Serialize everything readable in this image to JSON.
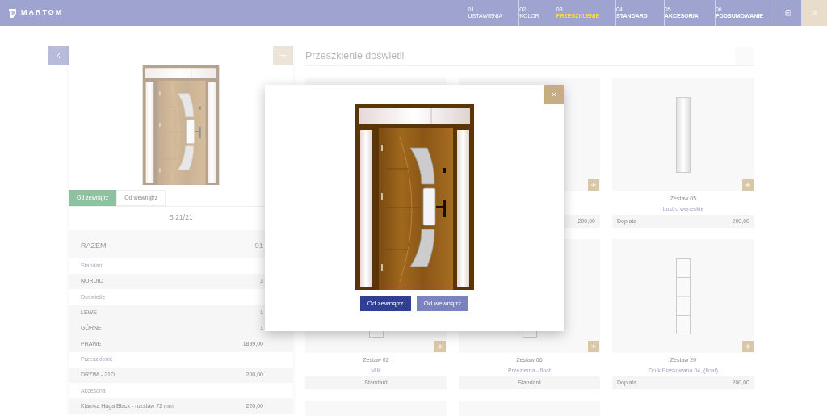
{
  "brand": {
    "name": "MARTOM"
  },
  "steps": [
    {
      "number": "01",
      "label": "USTAWIENIA",
      "selected": false,
      "completed": true
    },
    {
      "number": "02",
      "label": "KOLOR",
      "selected": false,
      "completed": true
    },
    {
      "number": "03",
      "label": "PRZESZKLENIE",
      "selected": true,
      "completed": false
    },
    {
      "number": "04",
      "label": "STANDARD",
      "selected": false,
      "completed": false
    },
    {
      "number": "05",
      "label": "AKCESORIA",
      "selected": false,
      "completed": false
    },
    {
      "number": "06",
      "label": "PODSUMOWANIE",
      "selected": false,
      "completed": false
    }
  ],
  "summary_panel": {
    "view_tabs": [
      {
        "label": "Od zewnątrz",
        "selected": true
      },
      {
        "label": "Od wewnątrz",
        "selected": false
      }
    ],
    "model": "B 21/21",
    "total_label": "RAZEM",
    "total_value": "91",
    "rows": [
      {
        "kind": "section",
        "label": "Standard"
      },
      {
        "kind": "item",
        "label": "NORDIC",
        "value": "3"
      },
      {
        "kind": "section",
        "label": "Doświetle"
      },
      {
        "kind": "item",
        "label": "LEWE",
        "value": "1"
      },
      {
        "kind": "item",
        "label": "GÓRNE",
        "value": "1"
      },
      {
        "kind": "item",
        "label": "PRAWE",
        "value": "1899,00"
      },
      {
        "kind": "section",
        "label": "Przeszklenie"
      },
      {
        "kind": "item",
        "label": "DRZWI - 21D",
        "value": "200,00"
      },
      {
        "kind": "section",
        "label": "Akcesoria"
      },
      {
        "kind": "item",
        "label": "Klamka Haga Black - rozstaw 72 mm",
        "value": "220,00"
      }
    ]
  },
  "glass_section": {
    "title": "Przeszklenie doświetli",
    "cards": [
      {
        "kind": "empty",
        "add_button": false
      },
      {
        "kind": "empty",
        "add_button": true,
        "price": "200,00"
      },
      {
        "kind": "single",
        "add_button": true,
        "title": "Zestaw 05",
        "subtitle": "Lustro weneckie",
        "price_label": "Dopłata",
        "price": "200,00"
      },
      {
        "kind": "small",
        "add_button": true,
        "title": "Zestaw 02",
        "subtitle": "Milk",
        "price_label": "Standard"
      },
      {
        "kind": "small",
        "add_button": true,
        "title": "Zestaw 06",
        "subtitle": "Przezierna - float",
        "price_label": "Standard"
      },
      {
        "kind": "segmented",
        "add_button": true,
        "title": "Zestaw 20",
        "subtitle": "Druk Piaskowana 04, (float)",
        "price_label": "Dopłata",
        "price": "200,00"
      },
      {
        "kind": "empty",
        "add_button": false
      },
      {
        "kind": "empty",
        "add_button": false
      }
    ]
  },
  "modal": {
    "view_buttons": [
      {
        "label": "Od zewnątrz",
        "selected": true
      },
      {
        "label": "Od wewnątrz",
        "selected": false
      }
    ]
  }
}
